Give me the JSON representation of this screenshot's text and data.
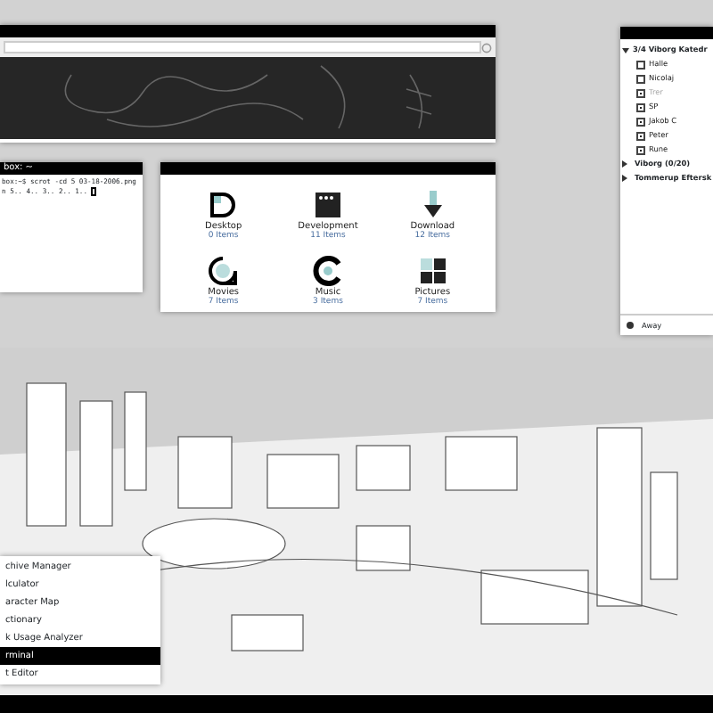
{
  "terminal": {
    "title": "box: ~",
    "lines": [
      "box:~$ scrot -cd 5 03-18-2006.png",
      "n 5.. 4.. 3.. 2.. 1.. "
    ]
  },
  "file_manager": {
    "items": [
      {
        "kind": "desktop",
        "name": "Desktop",
        "count": "0 Items"
      },
      {
        "kind": "development",
        "name": "Development",
        "count": "11 Items"
      },
      {
        "kind": "download",
        "name": "Download",
        "count": "12 Items"
      },
      {
        "kind": "movies",
        "name": "Movies",
        "count": "7 Items"
      },
      {
        "kind": "music",
        "name": "Music",
        "count": "3 Items"
      },
      {
        "kind": "pictures",
        "name": "Pictures",
        "count": "7 Items"
      }
    ]
  },
  "buddy_list": {
    "groups": [
      {
        "name": "3/4 Viborg Katedr",
        "expanded": true,
        "children": [
          {
            "name": "Halle",
            "checked": false,
            "idle": false
          },
          {
            "name": "Nicolaj",
            "checked": false,
            "idle": false
          },
          {
            "name": "Trer",
            "checked": true,
            "idle": true
          },
          {
            "name": "SP",
            "checked": true,
            "idle": false
          },
          {
            "name": "Jakob C",
            "checked": true,
            "idle": false
          },
          {
            "name": "Peter",
            "checked": true,
            "idle": false
          },
          {
            "name": "Rune",
            "checked": true,
            "idle": false
          }
        ]
      },
      {
        "name": "Viborg (0/20)",
        "expanded": false
      },
      {
        "name": "Tommerup Eftersk",
        "expanded": false
      }
    ],
    "status": "Away"
  },
  "menu": {
    "items": [
      {
        "label": "chive Manager",
        "selected": false
      },
      {
        "label": "lculator",
        "selected": false
      },
      {
        "label": "aracter Map",
        "selected": false
      },
      {
        "label": "ctionary",
        "selected": false
      },
      {
        "label": "k Usage Analyzer",
        "selected": false
      },
      {
        "label": "rminal",
        "selected": true
      },
      {
        "label": "t Editor",
        "selected": false
      }
    ]
  }
}
